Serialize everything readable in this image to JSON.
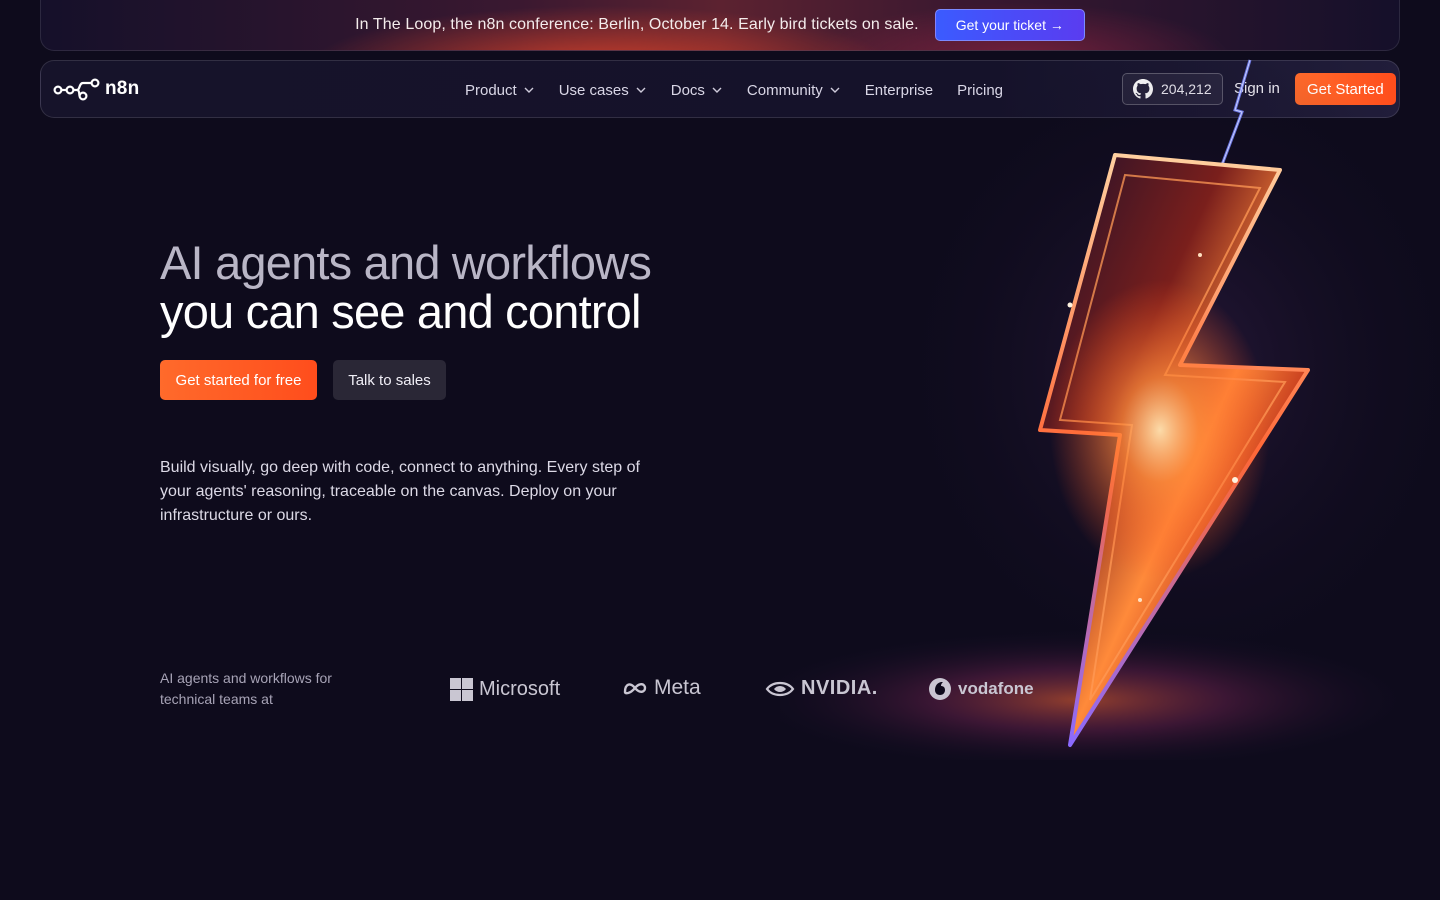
{
  "banner": {
    "text": "In The Loop, the n8n conference: Berlin, October 14. Early bird tickets on sale.",
    "button_label": "Get your ticket →"
  },
  "nav": {
    "logo_text": "n8n",
    "links": [
      {
        "label": "Product",
        "has_dropdown": true
      },
      {
        "label": "Use cases",
        "has_dropdown": true
      },
      {
        "label": "Docs",
        "has_dropdown": true
      },
      {
        "label": "Community",
        "has_dropdown": true
      },
      {
        "label": "Enterprise",
        "has_dropdown": false
      },
      {
        "label": "Pricing",
        "has_dropdown": false
      }
    ],
    "github_stars": "204,212",
    "sign_in": "Sign in",
    "get_started": "Get Started"
  },
  "hero": {
    "title_line1": "AI agents and workflows",
    "title_line2": "you can see and control",
    "cta_primary": "Get started for free",
    "cta_secondary": "Talk to sales",
    "lede": "Build visually, go deep with code, connect to anything. Every step of your agents' reasoning, traceable on the canvas. Deploy on your infrastructure or ours."
  },
  "trust": {
    "label": "AI agents and workflows for technical teams at",
    "logos": [
      "Microsoft",
      "Meta",
      "NVIDIA.",
      "vodafone"
    ]
  },
  "colors": {
    "background": "#0e0b1c",
    "accent_orange": "#ff5a22",
    "banner_button_blue": "#3b5bff"
  },
  "icons": {
    "github": "github-icon",
    "chevron": "chevron-down-icon",
    "logo": "n8n-logo-icon"
  }
}
